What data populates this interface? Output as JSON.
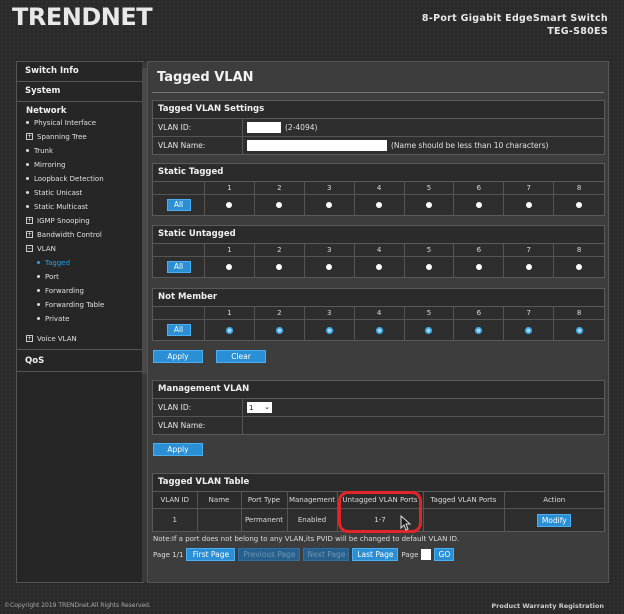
{
  "header": {
    "brand": "TRENDnet",
    "product_line": "8-Port Gigabit EdgeSmart Switch",
    "model": "TEG-S80ES"
  },
  "sidebar": {
    "switch_info": "Switch Info",
    "system": "System",
    "network": "Network",
    "items": [
      {
        "label": "Physical Interface",
        "type": "bullet"
      },
      {
        "label": "Spanning Tree",
        "type": "plus"
      },
      {
        "label": "Trunk",
        "type": "bullet"
      },
      {
        "label": "Mirroring",
        "type": "bullet"
      },
      {
        "label": "Loopback Detection",
        "type": "bullet"
      },
      {
        "label": "Static Unicast",
        "type": "bullet"
      },
      {
        "label": "Static Multicast",
        "type": "bullet"
      },
      {
        "label": "IGMP Snooping",
        "type": "plus"
      },
      {
        "label": "Bandwidth Control",
        "type": "plus"
      },
      {
        "label": "VLAN",
        "type": "minus"
      }
    ],
    "vlan_sub": [
      "Tagged",
      "Port",
      "Forwarding",
      "Forwarding Table",
      "Private"
    ],
    "voice_vlan": "Voice VLAN",
    "qos": "QoS"
  },
  "main": {
    "title": "Tagged VLAN",
    "settings": {
      "title": "Tagged VLAN Settings",
      "vlan_id_label": "VLAN ID:",
      "vlan_id_value": "",
      "vlan_id_hint": "(2-4094)",
      "vlan_name_label": "VLAN Name:",
      "vlan_name_value": "",
      "vlan_name_hint": "(Name should be less than 10 characters)"
    },
    "ports": [
      "1",
      "2",
      "3",
      "4",
      "5",
      "6",
      "7",
      "8"
    ],
    "all_label": "All",
    "static_tagged": {
      "title": "Static Tagged",
      "selected": [
        false,
        false,
        false,
        false,
        false,
        false,
        false,
        false
      ]
    },
    "static_untagged": {
      "title": "Static Untagged",
      "selected": [
        false,
        false,
        false,
        false,
        false,
        false,
        false,
        false
      ]
    },
    "not_member": {
      "title": "Not Member",
      "selected": [
        true,
        true,
        true,
        true,
        true,
        true,
        true,
        true
      ]
    },
    "apply_label": "Apply",
    "clear_label": "Clear",
    "management": {
      "title": "Management VLAN",
      "vlan_id_label": "VLAN ID:",
      "vlan_id_value": "1",
      "vlan_name_label": "VLAN Name:",
      "vlan_name_value": "",
      "apply_label": "Apply"
    },
    "table": {
      "title": "Tagged VLAN Table",
      "columns": [
        "VLAN ID",
        "Name",
        "Port Type",
        "Management",
        "Untagged VLAN Ports",
        "Tagged VLAN Ports",
        "Action"
      ],
      "rows": [
        {
          "vlan_id": "1",
          "name": "",
          "port_type": "Permanent",
          "management": "Enabled",
          "untagged": "1-7",
          "tagged": "",
          "action": "Modify"
        }
      ],
      "note": "Note:If a port does not belong to any VLAN,its PVID will be changed to default VLAN ID.",
      "page_info": "Page 1/1",
      "first_page": "First Page",
      "previous_page": "Previous Page",
      "next_page": "Next Page",
      "last_page": "Last Page",
      "page_label": "Page",
      "page_value": "",
      "go": "GO"
    }
  },
  "footer": {
    "copyright": "©Copyright 2019 TRENDnet.All Rights Reserved.",
    "warranty": "Product Warranty Registration"
  },
  "colors": {
    "accent": "#2a8fd4",
    "active_nav": "#2aa0e0",
    "highlight": "#e0262a"
  }
}
